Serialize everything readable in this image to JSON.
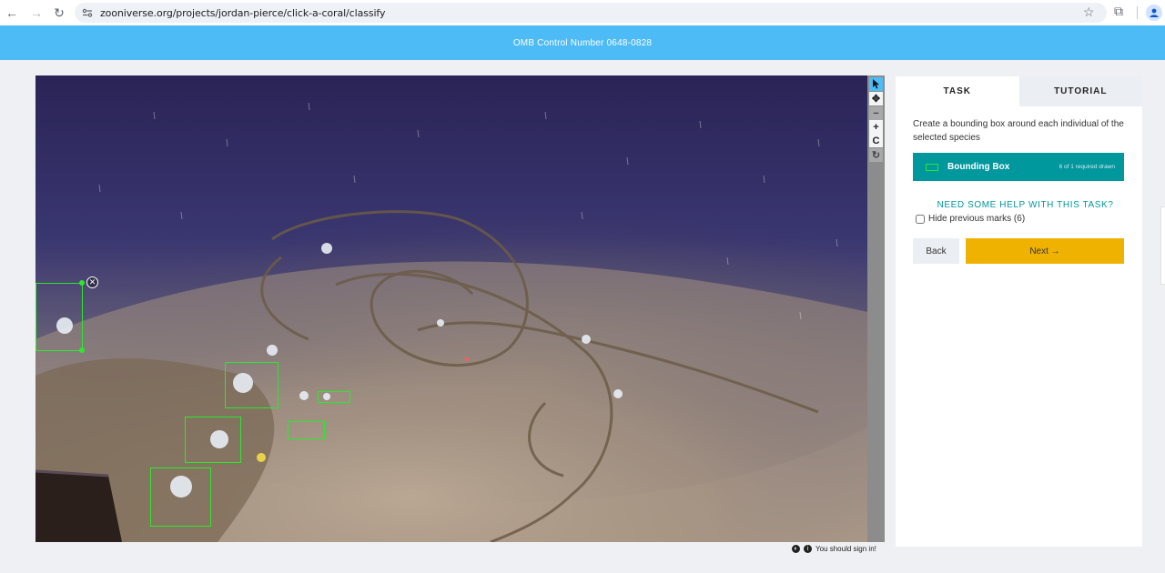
{
  "browser": {
    "url": "zooniverse.org/projects/jordan-pierce/click-a-coral/classify"
  },
  "banner": {
    "text": "OMB Control Number 0648-0828"
  },
  "viewer": {
    "tools": [
      "pointer-icon",
      "move-icon",
      "zoom-out-icon",
      "zoom-in-icon",
      "reset-icon",
      "rotate-icon"
    ],
    "footer_text": "You should sign in!"
  },
  "panel": {
    "tabs": [
      {
        "label": "TASK",
        "active": true
      },
      {
        "label": "TUTORIAL",
        "active": false
      }
    ],
    "instruction": "Create a bounding box around each individual of the selected species",
    "tool": {
      "label": "Bounding Box",
      "count_text": "6 of 1 required drawn",
      "color": "#2ee62e"
    },
    "help_text": "NEED SOME HELP WITH THIS TASK?",
    "hide_marks_label": "Hide previous marks (6)",
    "hide_marks_checked": false,
    "back_label": "Back",
    "next_label": "Next →"
  },
  "colors": {
    "banner": "#4dbbf6",
    "accent_teal": "#00979d",
    "next_button": "#f0b200",
    "mark": "#2ee62e"
  }
}
